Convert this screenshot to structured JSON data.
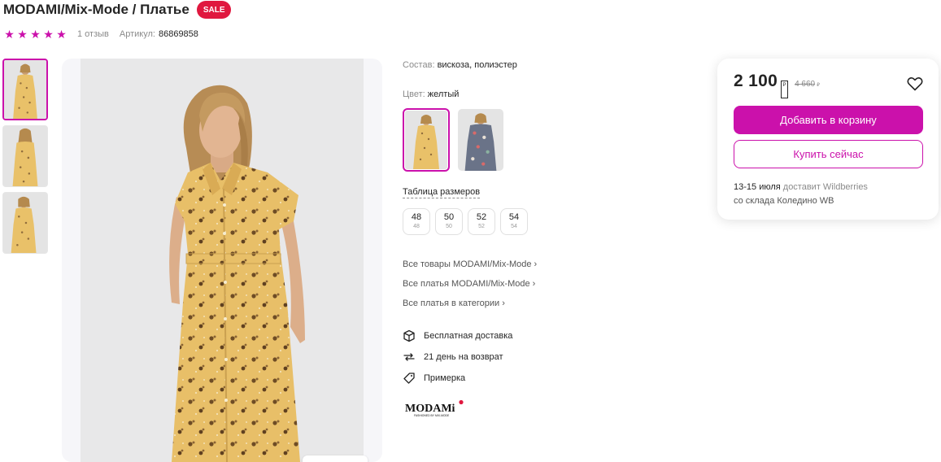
{
  "product": {
    "title": "MODAMI/Mix-Mode / Платье",
    "sale_badge": "SALE",
    "rating_stars": 5,
    "reviews": "1 отзыв",
    "article_label": "Артикул:",
    "article_value": "86869858"
  },
  "info": {
    "composition_label": "Состав:",
    "composition_value": "вискоза, полиэстер",
    "color_label": "Цвет:",
    "color_value": "желтый",
    "size_table_link": "Таблица размеров",
    "sizes": [
      {
        "main": "48",
        "sub": "48"
      },
      {
        "main": "50",
        "sub": "50"
      },
      {
        "main": "52",
        "sub": "52"
      },
      {
        "main": "54",
        "sub": "54"
      }
    ],
    "links": [
      "Все товары MODAMI/Mix-Mode",
      "Все платья MODAMI/Mix-Mode",
      "Все платья в категории"
    ],
    "features": [
      {
        "icon": "box-icon",
        "text": "Бесплатная доставка"
      },
      {
        "icon": "return-arrows-icon",
        "text": "21 день на возврат"
      },
      {
        "icon": "tag-icon",
        "text": "Примерка"
      }
    ],
    "brand_logo_text": "MODAMi",
    "brand_logo_subtext": "FASHIONED BY MIX-MODE"
  },
  "price_card": {
    "price": "2 100",
    "currency_symbol": "₽",
    "old_price": "4 660",
    "add_to_cart": "Добавить в корзину",
    "buy_now": "Купить сейчас",
    "delivery_dates": "13-15 июля",
    "delivery_text": " доставит Wildberries",
    "delivery_warehouse": "со склада Коледино WB"
  },
  "colors": {
    "accent": "#cb11ab",
    "sale": "#e0183f",
    "dress_yellow": "#e9c169"
  }
}
